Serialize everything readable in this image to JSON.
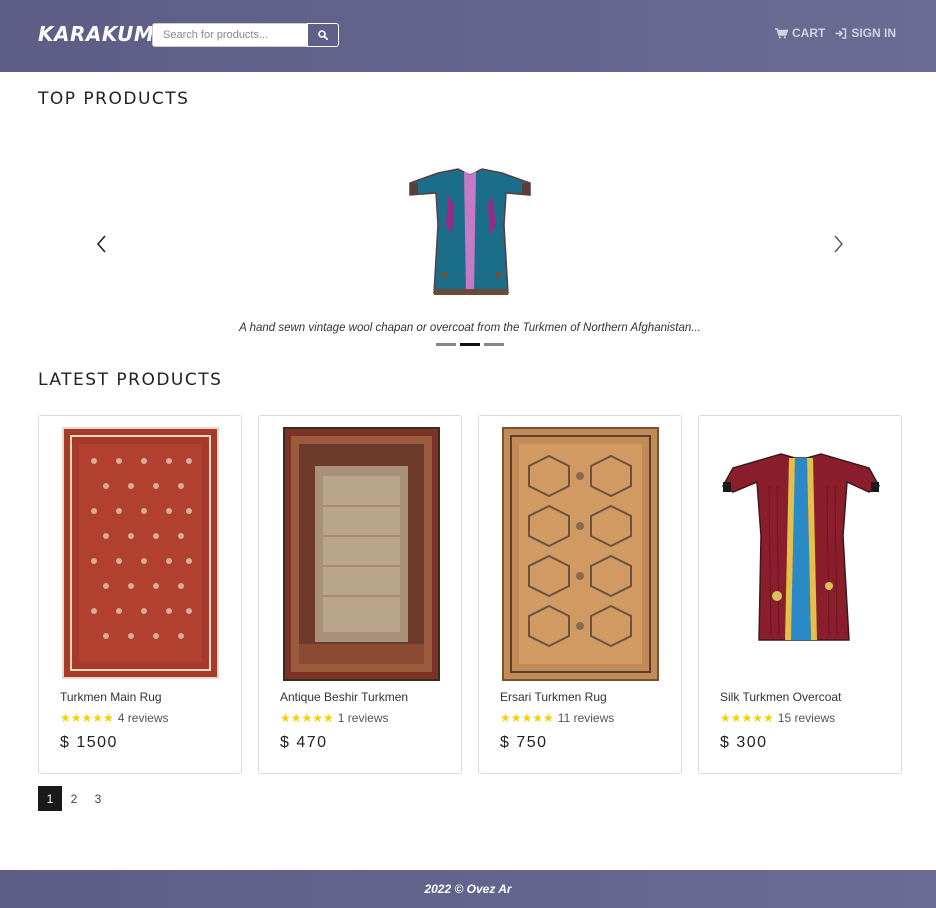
{
  "header": {
    "brand": "KARAKUM",
    "search_placeholder": "Search for products...",
    "cart_label": "CART",
    "signin_label": "SIGN IN"
  },
  "top_products": {
    "title": "TOP PRODUCTS",
    "caption": "A hand sewn vintage wool chapan or overcoat from the Turkmen of Northern Afghanistan...",
    "slide_count": 3,
    "active_slide": 2
  },
  "latest_products": {
    "title": "LATEST PRODUCTS",
    "items": [
      {
        "name": "Turkmen Main Rug",
        "rating": 5,
        "reviews": "4 reviews",
        "price": "$ 1500"
      },
      {
        "name": "Antique Beshir Turkmen",
        "rating": 5,
        "reviews": "1 reviews",
        "price": "$ 470"
      },
      {
        "name": "Ersari Turkmen Rug",
        "rating": 5,
        "reviews": "11 reviews",
        "price": "$ 750"
      },
      {
        "name": "Silk Turkmen Overcoat",
        "rating": 5,
        "reviews": "15 reviews",
        "price": "$ 300"
      }
    ]
  },
  "pagination": {
    "pages": [
      "1",
      "2",
      "3"
    ],
    "active": "1"
  },
  "footer": {
    "text": "2022 © Ovez Ar"
  },
  "colors": {
    "header_bg": "#5f6088",
    "star": "#f6d000",
    "active_page": "#1a1a1a"
  },
  "icons": [
    "search-icon",
    "cart-icon",
    "sign-in-icon",
    "chevron-left-icon",
    "chevron-right-icon",
    "star-icon"
  ]
}
